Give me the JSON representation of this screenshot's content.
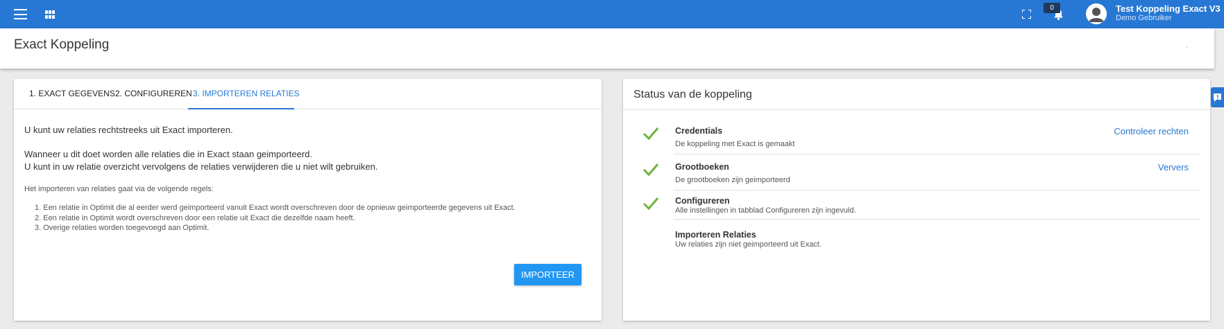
{
  "topbar": {
    "notification_count": "0",
    "user_name": "Test Koppeling Exact V3",
    "user_role": "Demo Gebruiker",
    "icons": [
      "menu-icon",
      "apps-icon",
      "fullscreen-icon",
      "bell-icon",
      "avatar-icon"
    ],
    "accent_color": "#2778d4"
  },
  "page": {
    "title": "Exact Koppeling",
    "header_dot": "·"
  },
  "left_card": {
    "tabs": [
      {
        "label": "1. EXACT GEGEVENS",
        "active": false
      },
      {
        "label": "2. CONFIGUREREN",
        "active": false
      },
      {
        "label": "3. IMPORTEREN RELATIES",
        "active": true
      }
    ],
    "intro": "U kunt uw relaties rechtstreeks uit Exact importeren.",
    "line2": "Wanneer u dit doet worden alle relaties die in Exact staan geimporteerd.",
    "line3": "U kunt in uw relatie overzicht vervolgens de relaties verwijderen die u niet wilt gebruiken.",
    "rules_intro": "Het importeren van relaties gaat via de volgende regels:",
    "rules": [
      "1. Een relatie in Optimit die al eerder werd geimporteerd vanuit Exact wordt overschreven door de opnieuw geimporteerde gegevens uit Exact.",
      "2. Een relatie in Optimit wordt overschreven door een relatie uit Exact die dezelfde naam heeft.",
      "3. Overige relaties worden toegevoegd aan Optimit."
    ],
    "import_button": "IMPORTEER"
  },
  "right_card": {
    "title": "Status van de koppeling",
    "items": [
      {
        "label": "Credentials",
        "desc": "De koppeling met Exact is gemaakt",
        "action": "Controleer rechten",
        "done": true
      },
      {
        "label": "Grootboeken",
        "desc": "De grootboeken zijn geimporteerd",
        "action": "Ververs",
        "done": true
      },
      {
        "label": "Configureren",
        "desc": "Alle instellingen in tabblad Configureren zijn ingevuld.",
        "action": "",
        "done": true
      },
      {
        "label": "Importeren Relaties",
        "desc": "Uw relaties zijn niet geimporteerd uit Exact.",
        "action": "",
        "done": false
      }
    ],
    "check_color": "#6cb33f"
  }
}
